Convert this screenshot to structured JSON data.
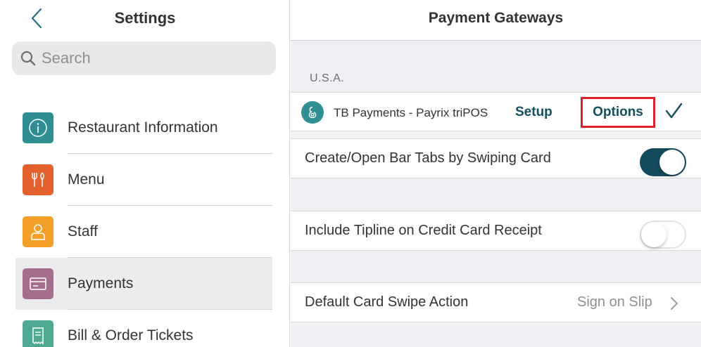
{
  "left_panel": {
    "title": "Settings",
    "search": {
      "placeholder": "Search"
    },
    "menu": [
      {
        "label": "Restaurant Information",
        "icon": "info-icon",
        "color": "#2e8e91"
      },
      {
        "label": "Menu",
        "icon": "fork-knife-icon",
        "color": "#e4612d"
      },
      {
        "label": "Staff",
        "icon": "person-icon",
        "color": "#f4a028"
      },
      {
        "label": "Payments",
        "icon": "card-icon",
        "color": "#a46e8c"
      },
      {
        "label": "Bill & Order Tickets",
        "icon": "receipt-icon",
        "color": "#4fa891"
      }
    ]
  },
  "right_panel": {
    "title": "Payment Gateways",
    "section_label": "U.S.A.",
    "gateway": {
      "name": "TB Payments - Payrix triPOS",
      "setup_label": "Setup",
      "options_label": "Options"
    },
    "bar_tabs": {
      "label": "Create/Open Bar Tabs by Swiping Card",
      "enabled": true
    },
    "tipline": {
      "label": "Include Tipline on Credit Card Receipt",
      "enabled": false
    },
    "swipe_action": {
      "label": "Default Card Swipe Action",
      "value": "Sign on Slip"
    }
  },
  "colors": {
    "accent": "#13505e",
    "highlight_border": "#d9232e",
    "toggle_on": "#134a5c"
  }
}
